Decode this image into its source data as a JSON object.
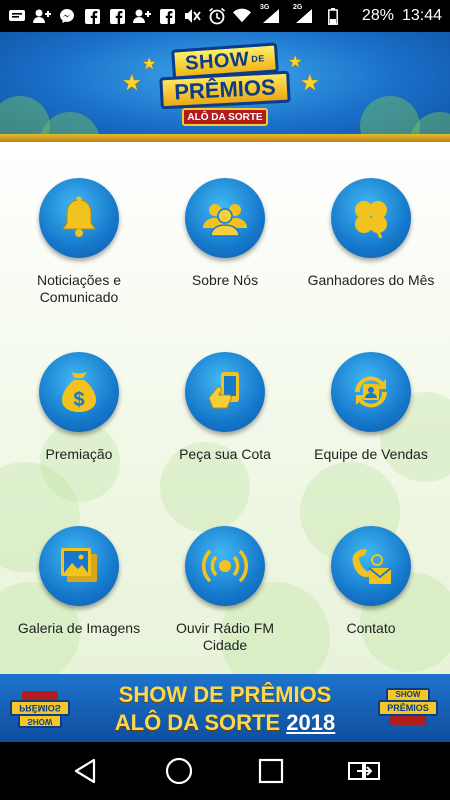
{
  "status_bar": {
    "battery": "28%",
    "time": "13:44",
    "network_1": "3G",
    "network_2": "2G"
  },
  "header": {
    "logo_line1": "SHOW",
    "logo_de": "DE",
    "logo_line2": "PRÊMIOS",
    "logo_line3": "ALÔ DA SORTE"
  },
  "menu": {
    "items": [
      {
        "label": "Noticiações e Comunicado",
        "icon": "bell-icon"
      },
      {
        "label": "Sobre Nós",
        "icon": "group-icon"
      },
      {
        "label": "Ganhadores do Mês",
        "icon": "clover-icon"
      },
      {
        "label": "Premiação",
        "icon": "money-bag-icon"
      },
      {
        "label": "Peça sua Cota",
        "icon": "phone-hand-icon"
      },
      {
        "label": "Equipe de Vendas",
        "icon": "contact-refresh-icon"
      },
      {
        "label": "Galeria de Imagens",
        "icon": "gallery-icon"
      },
      {
        "label": "Ouvir Rádio FM Cidade",
        "icon": "broadcast-icon"
      },
      {
        "label": "Contato",
        "icon": "phone-mail-icon"
      }
    ]
  },
  "banner": {
    "line1": "SHOW DE PRÊMIOS",
    "line2": "ALÔ DA SORTE",
    "year": "2018",
    "mini_logo_top": "SHOW",
    "mini_logo_bottom": "PRÊMIOS",
    "mini_logo_top_mirrored": "SHOW",
    "mini_logo_bottom_mirrored": "PRÊMIOS"
  },
  "colors": {
    "gold": "#f2c21e",
    "circle_blue": "#1679cc",
    "header_blue": "#1a6fc8"
  }
}
